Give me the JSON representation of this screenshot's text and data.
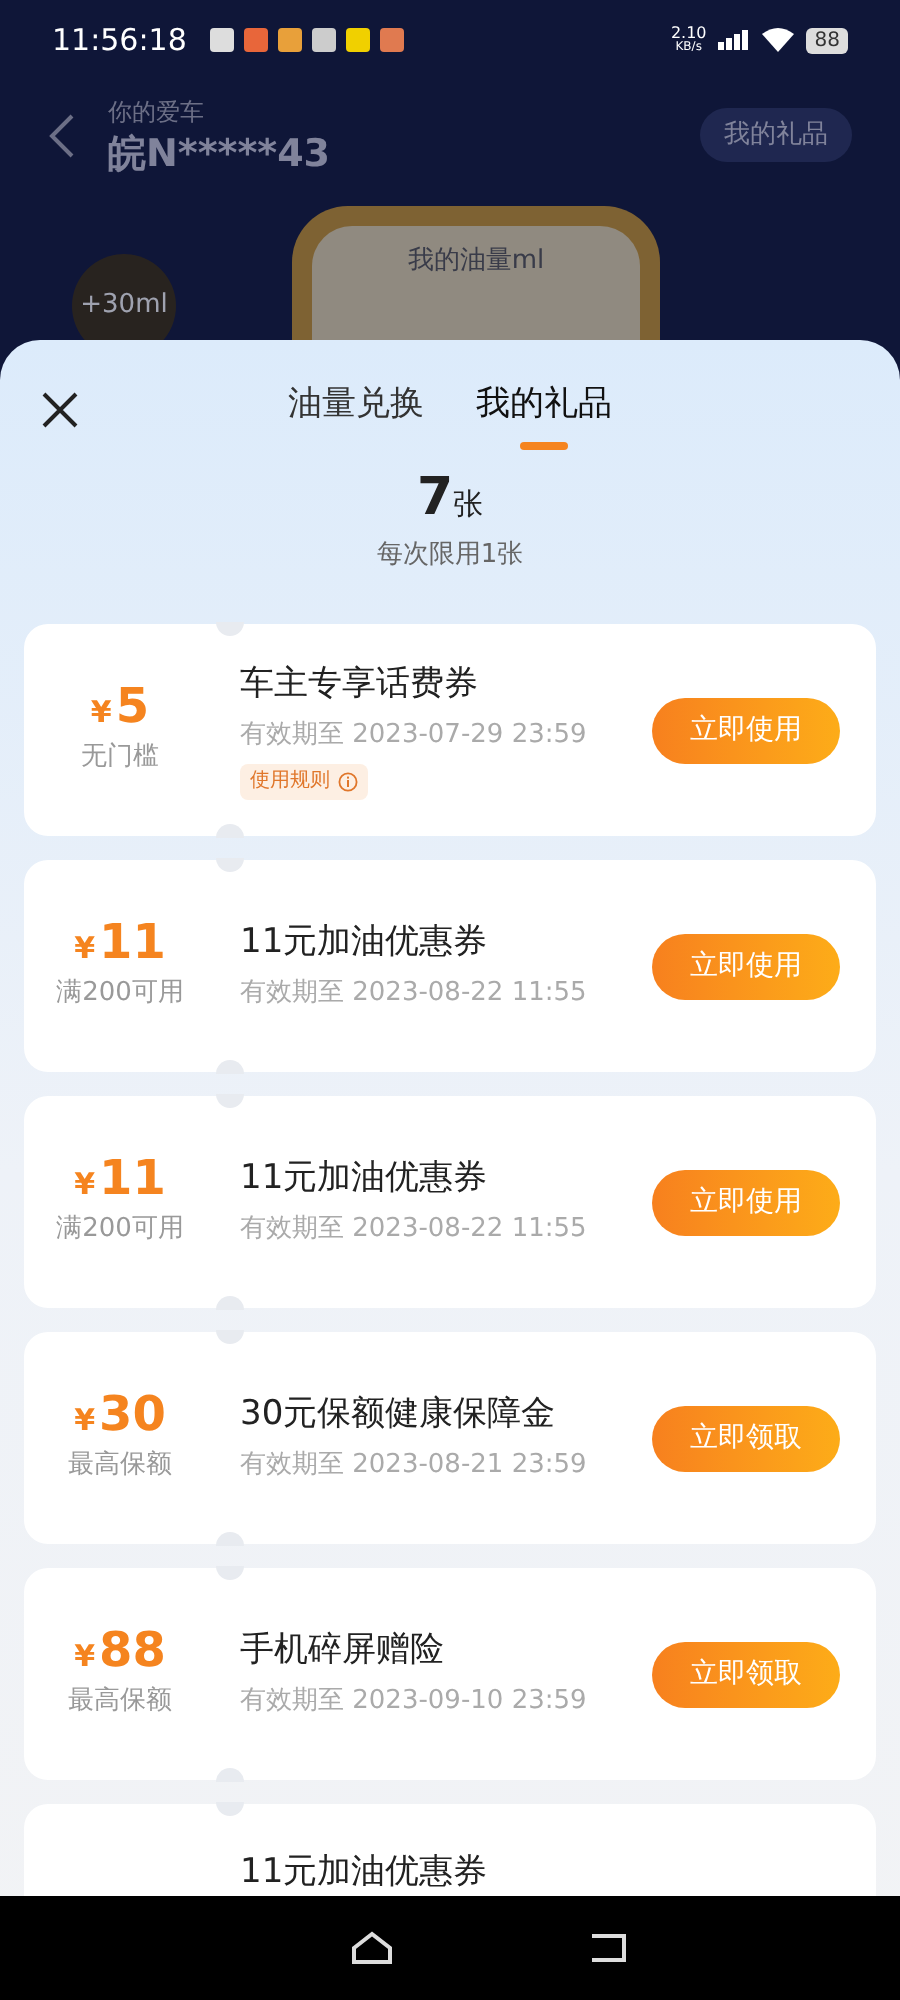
{
  "status_bar": {
    "time": "11:56:18",
    "network_speed": "2.10",
    "speed_unit": "KB/s",
    "battery": "88"
  },
  "background_page": {
    "car_label": "你的爱车",
    "plate": "皖N*****43",
    "gift_button": "我的礼品",
    "bonus": "+30ml",
    "oil_label": "我的油量ml"
  },
  "sheet": {
    "tabs": [
      {
        "label": "油量兑换",
        "selected": false
      },
      {
        "label": "我的礼品",
        "selected": true
      }
    ],
    "count": "7",
    "count_unit": "张",
    "limit_note": "每次限用1张",
    "coupons": [
      {
        "currency": "¥",
        "amount": "5",
        "condition": "无门槛",
        "title": "车主专享话费券",
        "expiry": "有效期至 2023-07-29 23:59",
        "rules_tag": "使用规则",
        "action": "立即使用"
      },
      {
        "currency": "¥",
        "amount": "11",
        "condition": "满200可用",
        "title": "11元加油优惠券",
        "expiry": "有效期至 2023-08-22 11:55",
        "action": "立即使用"
      },
      {
        "currency": "¥",
        "amount": "11",
        "condition": "满200可用",
        "title": "11元加油优惠券",
        "expiry": "有效期至 2023-08-22 11:55",
        "action": "立即使用"
      },
      {
        "currency": "¥",
        "amount": "30",
        "condition": "最高保额",
        "title": "30元保额健康保障金",
        "expiry": "有效期至 2023-08-21 23:59",
        "action": "立即领取"
      },
      {
        "currency": "¥",
        "amount": "88",
        "condition": "最高保额",
        "title": "手机碎屏赠险",
        "expiry": "有效期至 2023-09-10 23:59",
        "action": "立即领取"
      },
      {
        "title": "11元加油优惠券"
      }
    ]
  }
}
